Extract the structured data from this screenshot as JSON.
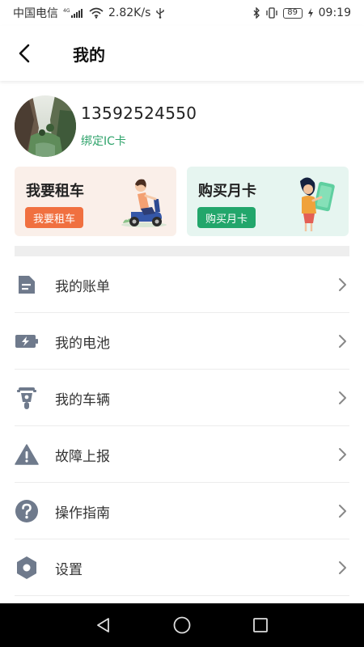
{
  "status_bar": {
    "carrier": "中国电信",
    "network": "4G",
    "speed": "2.82K/s",
    "battery": "89",
    "time": "09:19"
  },
  "header": {
    "title": "我的"
  },
  "profile": {
    "phone": "13592524550",
    "bind_card_label": "绑定IC卡"
  },
  "cards": {
    "rent": {
      "title": "我要租车",
      "button": "我要租车"
    },
    "month": {
      "title": "购买月卡",
      "button": "购买月卡"
    }
  },
  "menu": {
    "items": [
      {
        "label": "我的账单",
        "icon": "bill-icon"
      },
      {
        "label": "我的电池",
        "icon": "battery-icon"
      },
      {
        "label": "我的车辆",
        "icon": "vehicle-icon"
      },
      {
        "label": "故障上报",
        "icon": "warning-icon"
      },
      {
        "label": "操作指南",
        "icon": "help-icon"
      },
      {
        "label": "设置",
        "icon": "settings-icon"
      }
    ]
  },
  "colors": {
    "accent_green": "#2fa36b",
    "rent_button": "#f07040",
    "month_button": "#22a66b",
    "rent_card_bg": "#faefe9",
    "month_card_bg": "#e6f5f0"
  }
}
